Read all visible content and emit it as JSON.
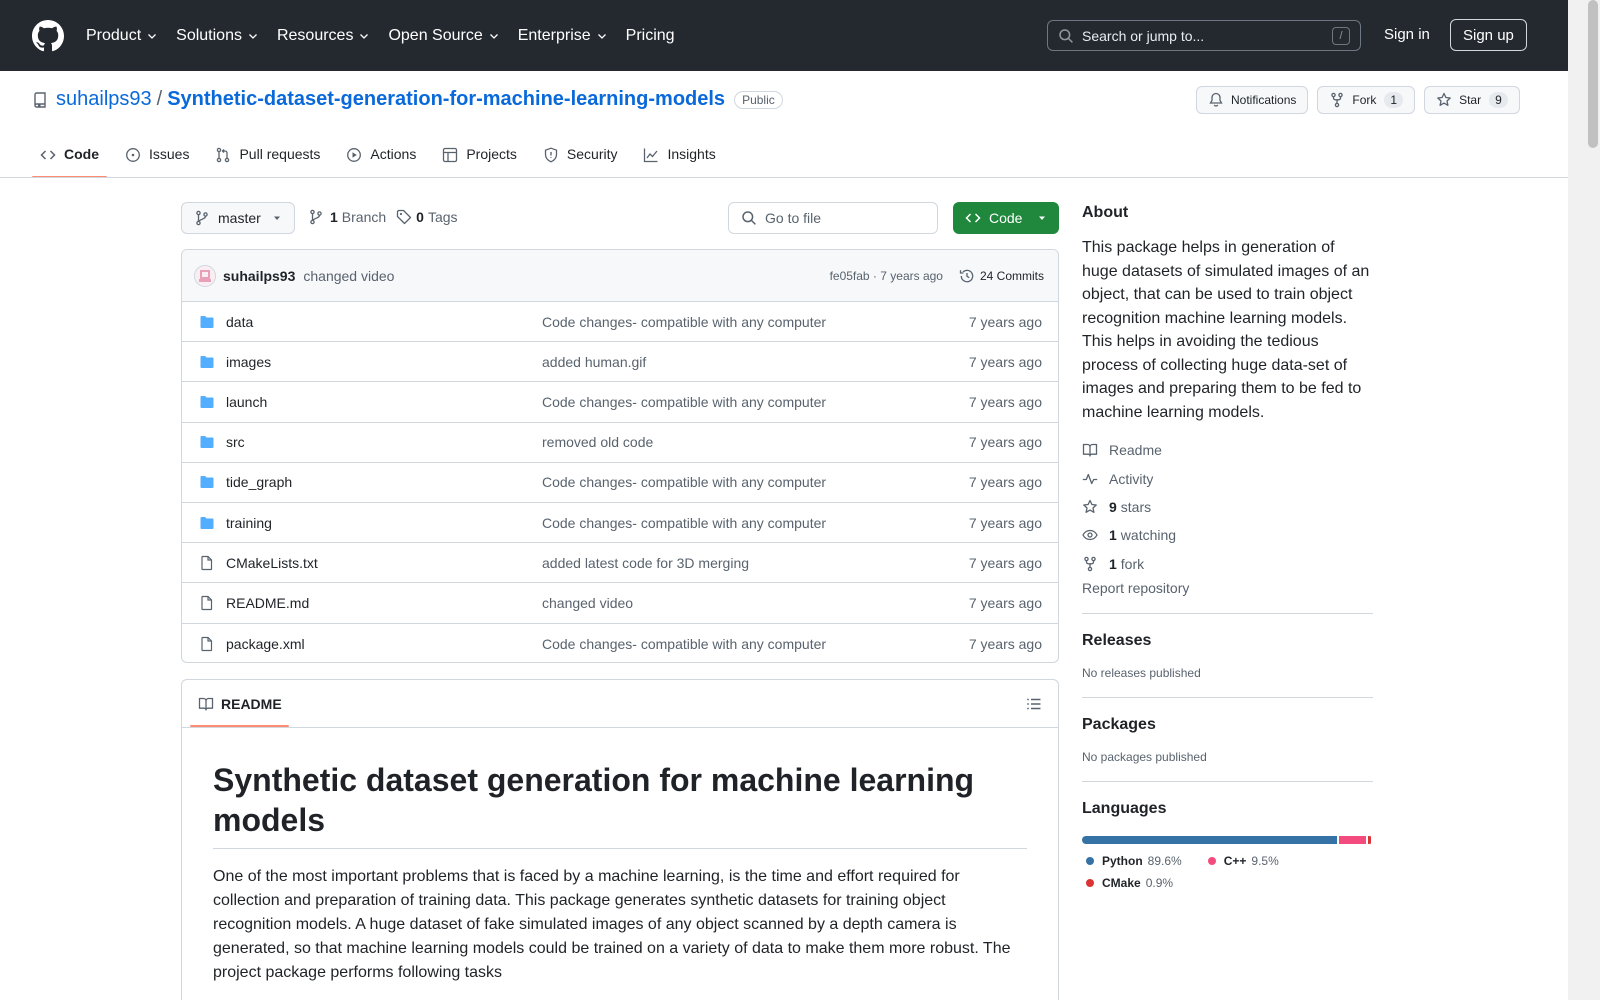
{
  "header": {
    "nav": [
      "Product",
      "Solutions",
      "Resources",
      "Open Source",
      "Enterprise",
      "Pricing"
    ],
    "search_placeholder": "Search or jump to...",
    "search_key": "/",
    "signin": "Sign in",
    "signup": "Sign up"
  },
  "repo": {
    "owner": "suhailps93",
    "separator": "/",
    "name": "Synthetic-dataset-generation-for-machine-learning-models",
    "visibility": "Public",
    "notifications_label": "Notifications",
    "fork_label": "Fork",
    "fork_count": "1",
    "star_label": "Star",
    "star_count": "9"
  },
  "tabs": [
    "Code",
    "Issues",
    "Pull requests",
    "Actions",
    "Projects",
    "Security",
    "Insights"
  ],
  "filenav": {
    "branch": "master",
    "branch_count": "1",
    "branch_label": "Branch",
    "tag_count": "0",
    "tag_label": "Tags",
    "goto_placeholder": "Go to file",
    "code_label": "Code"
  },
  "commit": {
    "author": "suhailps93",
    "message": "changed video",
    "meta": "fe05fab · 7 years ago",
    "commits": "24 Commits"
  },
  "files": [
    {
      "type": "dir",
      "name": "data",
      "message": "Code changes- compatible with any computer",
      "date": "7 years ago"
    },
    {
      "type": "dir",
      "name": "images",
      "message": "added human.gif",
      "date": "7 years ago"
    },
    {
      "type": "dir",
      "name": "launch",
      "message": "Code changes- compatible with any computer",
      "date": "7 years ago"
    },
    {
      "type": "dir",
      "name": "src",
      "message": "removed old code",
      "date": "7 years ago"
    },
    {
      "type": "dir",
      "name": "tide_graph",
      "message": "Code changes- compatible with any computer",
      "date": "7 years ago"
    },
    {
      "type": "dir",
      "name": "training",
      "message": "Code changes- compatible with any computer",
      "date": "7 years ago"
    },
    {
      "type": "file",
      "name": "CMakeLists.txt",
      "message": "added latest code for 3D merging",
      "date": "7 years ago"
    },
    {
      "type": "file",
      "name": "README.md",
      "message": "changed video",
      "date": "7 years ago"
    },
    {
      "type": "file",
      "name": "package.xml",
      "message": "Code changes- compatible with any computer",
      "date": "7 years ago"
    }
  ],
  "readme": {
    "tab": "README",
    "title": "Synthetic dataset generation for machine learning models",
    "paragraph": "One of the most important problems that is faced by a machine learning, is the time and effort required for collection and preparation of training data. This package generates synthetic datasets for training object recognition models. A huge dataset of fake simulated images of any object scanned by a depth camera is generated, so that machine learning models could be trained on a variety of data to make them more robust. The project package performs following tasks"
  },
  "about": {
    "title": "About",
    "description": "This package helps in generation of huge datasets of simulated images of an object, that can be used to train object recognition machine learning models. This helps in avoiding the tedious process of collecting huge data-set of images and preparing them to be fed to machine learning models.",
    "readme": "Readme",
    "activity": "Activity",
    "stars_count": "9",
    "stars_label": "stars",
    "watching_count": "1",
    "watching_label": "watching",
    "fork_count": "1",
    "fork_label": "fork",
    "report": "Report repository"
  },
  "releases": {
    "title": "Releases",
    "empty": "No releases published"
  },
  "packages": {
    "title": "Packages",
    "empty": "No packages published"
  },
  "languages": {
    "title": "Languages",
    "items": [
      {
        "name": "Python",
        "percent": "89.6%",
        "value": 89.6,
        "color": "#3572A5"
      },
      {
        "name": "C++",
        "percent": "9.5%",
        "value": 9.5,
        "color": "#f34b7d"
      },
      {
        "name": "CMake",
        "percent": "0.9%",
        "value": 0.9,
        "color": "#DA3434"
      }
    ]
  }
}
